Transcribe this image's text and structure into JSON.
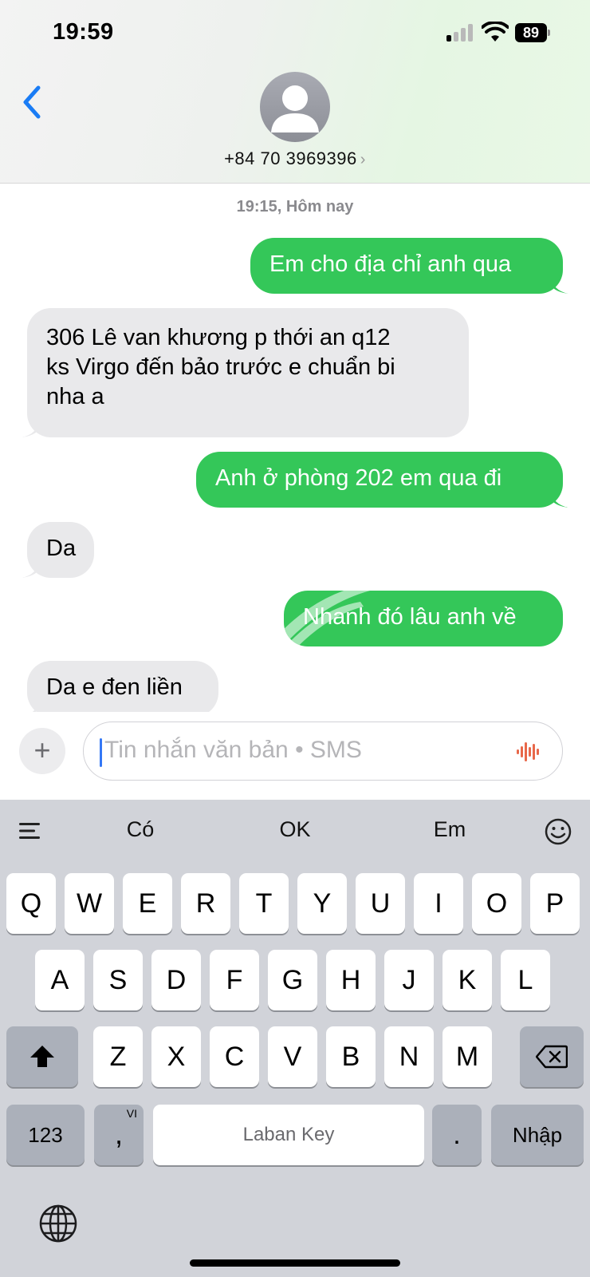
{
  "status_bar": {
    "time": "19:59",
    "battery": "89"
  },
  "header": {
    "contact": "+84 70 3969396",
    "chevron": "›"
  },
  "thread": {
    "timestamp_time": "19:15,",
    "timestamp_day": "Hôm nay",
    "messages": [
      {
        "from": "me",
        "text": "Em cho địa chỉ anh qua"
      },
      {
        "from": "them",
        "line1": "306 Lê van khương p thới an q12",
        "line2": "ks Virgo đến bảo trước e chuẩn bi",
        "line3": "nha a"
      },
      {
        "from": "me",
        "text": "Anh ở phòng 202 em qua đi"
      },
      {
        "from": "them",
        "text": "Da"
      },
      {
        "from": "me",
        "text": "Nhanh đó lâu anh về"
      },
      {
        "from": "them",
        "text": "Da e đen liền"
      }
    ]
  },
  "input": {
    "plus": "+",
    "placeholder": "Tin nhắn văn bản • SMS"
  },
  "keyboard": {
    "suggestions": [
      "Có",
      "OK",
      "Em"
    ],
    "row1": [
      "Q",
      "W",
      "E",
      "R",
      "T",
      "Y",
      "U",
      "I",
      "O",
      "P"
    ],
    "row2": [
      "A",
      "S",
      "D",
      "F",
      "G",
      "H",
      "J",
      "K",
      "L"
    ],
    "row3": [
      "Z",
      "X",
      "C",
      "V",
      "B",
      "N",
      "M"
    ],
    "numbers_key": "123",
    "lang_key_label": "VI",
    "comma_key": ",",
    "space_label": "Laban Key",
    "period_key": ".",
    "return_label": "Nhập"
  },
  "colors": {
    "sent_bubble": "#34c759",
    "received_bubble": "#e9e9eb",
    "accent": "#3478f6"
  }
}
